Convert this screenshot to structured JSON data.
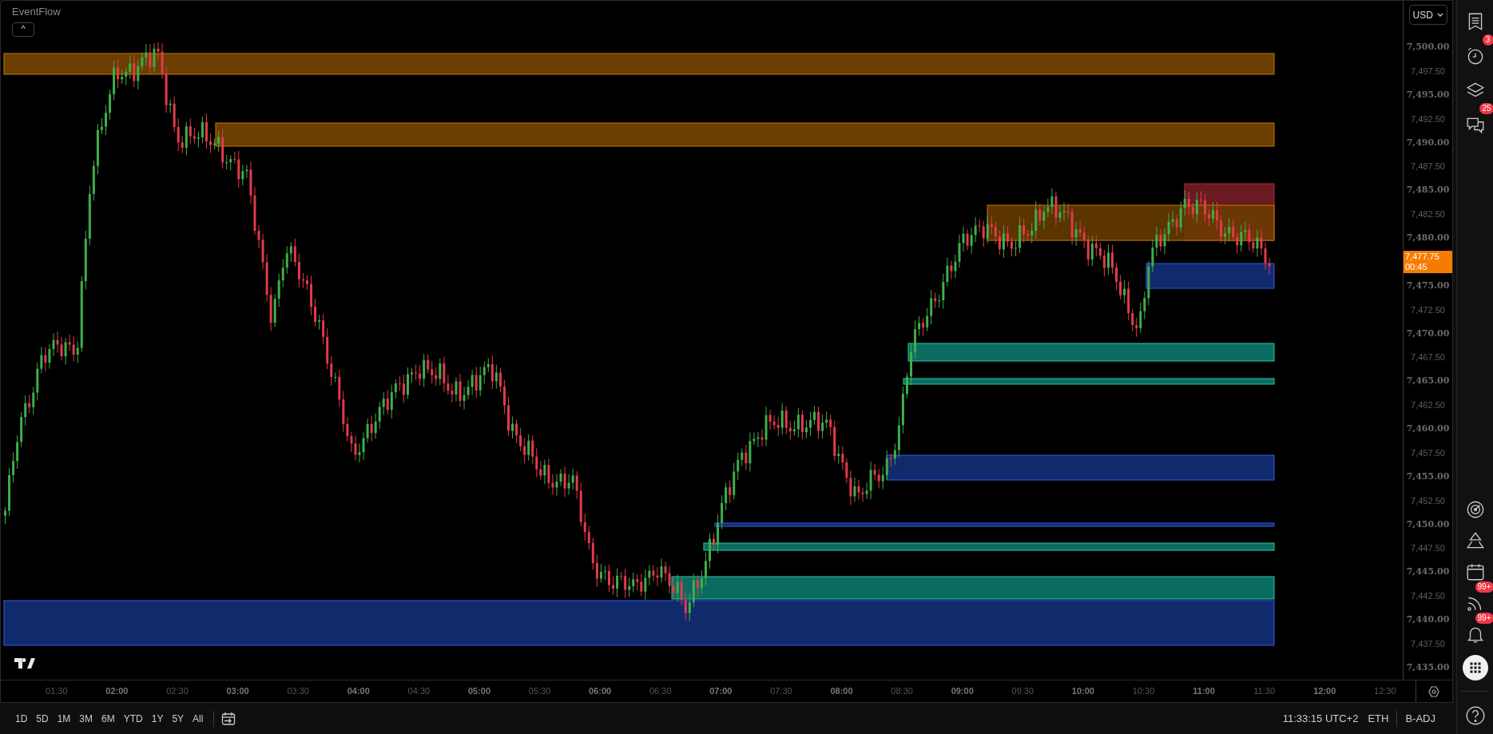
{
  "chart_header": {
    "title": "EventFlow",
    "collapse_button": "^"
  },
  "price_axis": {
    "currency": "USD",
    "labels": [
      {
        "kind": "major",
        "text": "7,500.00"
      },
      {
        "kind": "minor",
        "text": "7,497.50"
      },
      {
        "kind": "major",
        "text": "7,495.00"
      },
      {
        "kind": "minor",
        "text": "7,492.50"
      },
      {
        "kind": "major",
        "text": "7,490.00"
      },
      {
        "kind": "minor",
        "text": "7,487.50"
      },
      {
        "kind": "major",
        "text": "7,485.00"
      },
      {
        "kind": "minor",
        "text": "7,482.50"
      },
      {
        "kind": "major",
        "text": "7,480.00"
      },
      {
        "kind": "current",
        "text": "7,477.75",
        "countdown": "00:45"
      },
      {
        "kind": "major",
        "text": "7,475.00"
      },
      {
        "kind": "minor",
        "text": "7,472.50"
      },
      {
        "kind": "major",
        "text": "7,470.00"
      },
      {
        "kind": "minor",
        "text": "7,467.50"
      },
      {
        "kind": "major",
        "text": "7,465.00"
      },
      {
        "kind": "minor",
        "text": "7,462.50"
      },
      {
        "kind": "major",
        "text": "7,460.00"
      },
      {
        "kind": "minor",
        "text": "7,457.50"
      },
      {
        "kind": "major",
        "text": "7,455.00"
      },
      {
        "kind": "minor",
        "text": "7,452.50"
      },
      {
        "kind": "major",
        "text": "7,450.00"
      },
      {
        "kind": "minor",
        "text": "7,447.50"
      },
      {
        "kind": "major",
        "text": "7,445.00"
      },
      {
        "kind": "minor",
        "text": "7,442.50"
      },
      {
        "kind": "major",
        "text": "7,440.00"
      },
      {
        "kind": "minor",
        "text": "7,437.50"
      },
      {
        "kind": "major",
        "text": "7,435.00"
      }
    ]
  },
  "time_axis": {
    "labels": [
      {
        "kind": "minor",
        "text": "01:30"
      },
      {
        "kind": "major",
        "text": "02:00"
      },
      {
        "kind": "minor",
        "text": "02:30"
      },
      {
        "kind": "major",
        "text": "03:00"
      },
      {
        "kind": "minor",
        "text": "03:30"
      },
      {
        "kind": "major",
        "text": "04:00"
      },
      {
        "kind": "minor",
        "text": "04:30"
      },
      {
        "kind": "major",
        "text": "05:00"
      },
      {
        "kind": "minor",
        "text": "05:30"
      },
      {
        "kind": "major",
        "text": "06:00"
      },
      {
        "kind": "minor",
        "text": "06:30"
      },
      {
        "kind": "major",
        "text": "07:00"
      },
      {
        "kind": "minor",
        "text": "07:30"
      },
      {
        "kind": "major",
        "text": "08:00"
      },
      {
        "kind": "minor",
        "text": "08:30"
      },
      {
        "kind": "major",
        "text": "09:00"
      },
      {
        "kind": "minor",
        "text": "09:30"
      },
      {
        "kind": "major",
        "text": "10:00"
      },
      {
        "kind": "minor",
        "text": "10:30"
      },
      {
        "kind": "major",
        "text": "11:00"
      },
      {
        "kind": "minor",
        "text": "11:30"
      },
      {
        "kind": "major",
        "text": "12:00"
      },
      {
        "kind": "minor",
        "text": "12:30"
      }
    ]
  },
  "bottom_bar": {
    "ranges": [
      "1D",
      "5D",
      "1M",
      "3M",
      "6M",
      "YTD",
      "1Y",
      "5Y",
      "All"
    ],
    "clock": "11:33:15 UTC+2",
    "session": "ETH",
    "adjustment": "B-ADJ"
  },
  "sidebar": {
    "top_items": [
      {
        "kind": "watchlist"
      },
      {
        "kind": "alerts",
        "badge": "3"
      },
      {
        "kind": "layers"
      },
      {
        "kind": "chats",
        "badge": "25"
      }
    ],
    "bottom_items": [
      {
        "kind": "target"
      },
      {
        "kind": "ideas"
      },
      {
        "kind": "calendar"
      },
      {
        "kind": "feed",
        "badge": "99+"
      },
      {
        "kind": "bell",
        "badge": "99+"
      },
      {
        "kind": "apps"
      },
      {
        "kind": "help"
      }
    ]
  }
}
